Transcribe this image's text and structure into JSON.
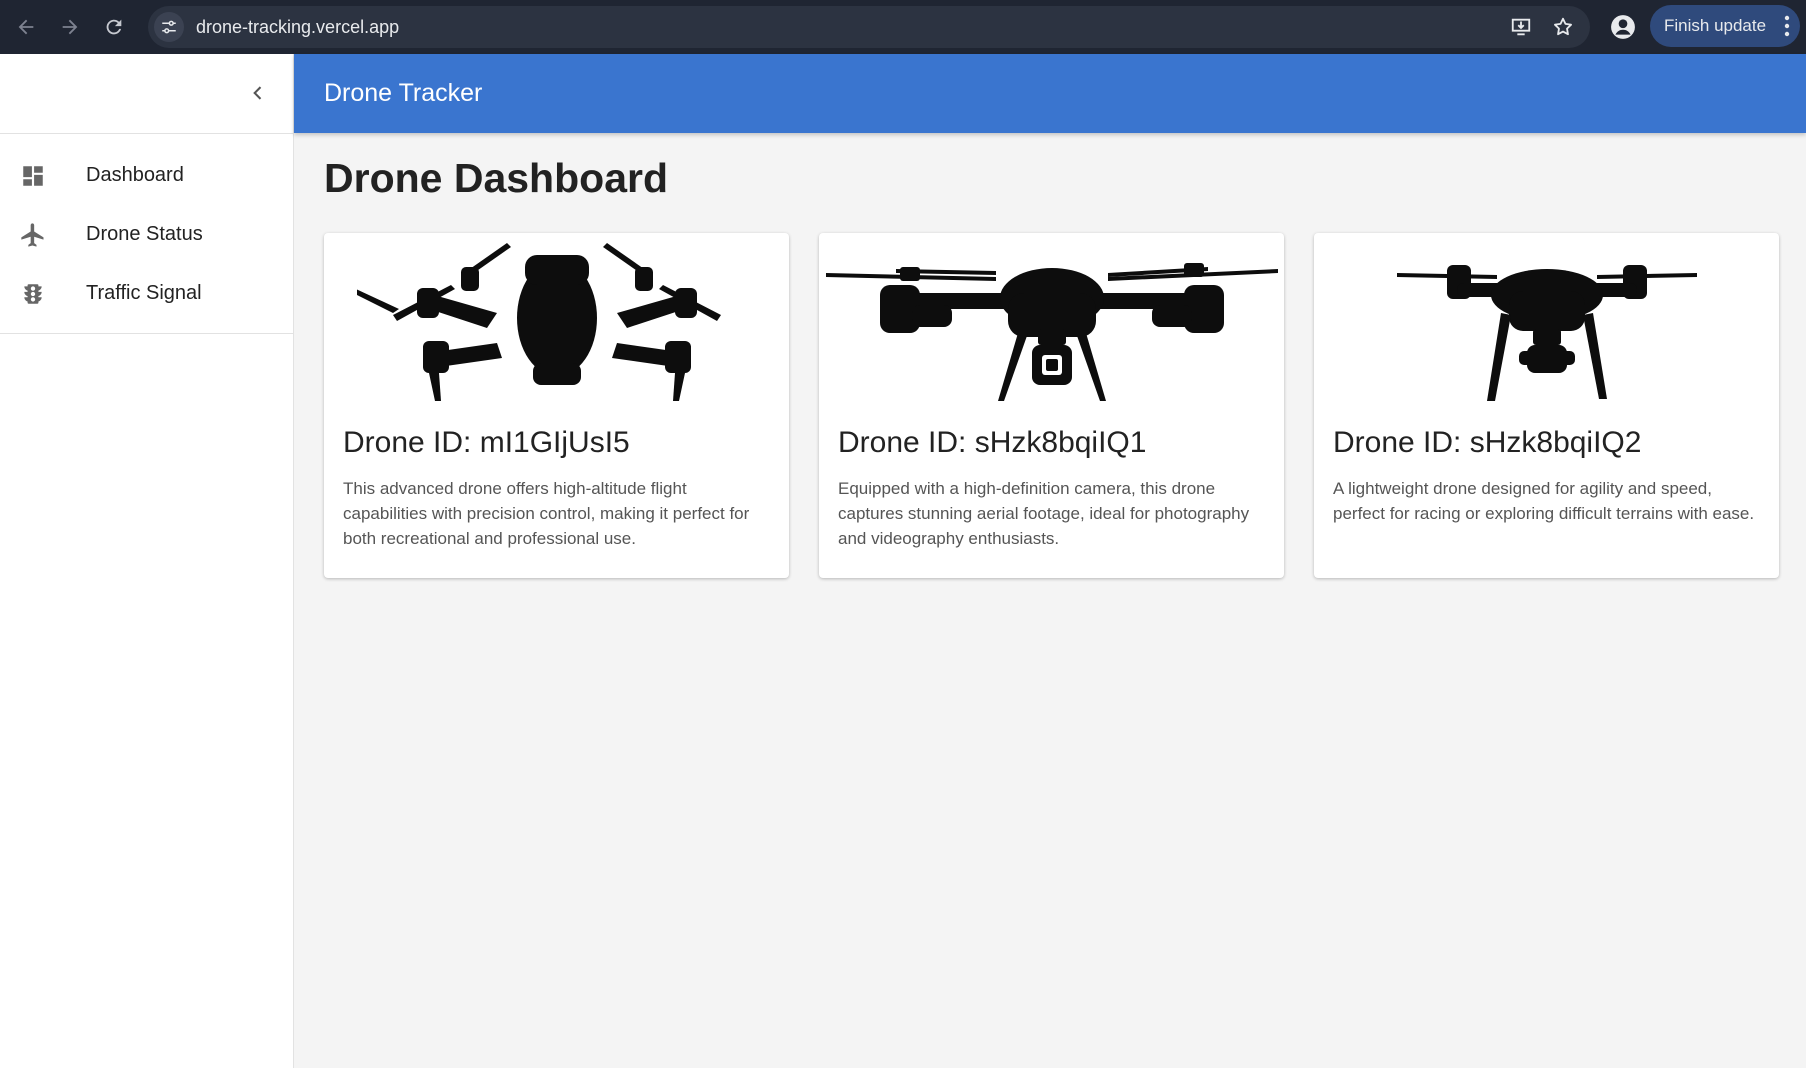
{
  "browser": {
    "url": "drone-tracking.vercel.app",
    "update_label": "Finish update",
    "icons": [
      "back-arrow-icon",
      "forward-arrow-icon",
      "reload-icon",
      "site-info-icon",
      "install-app-icon",
      "bookmark-star-icon",
      "profile-icon",
      "more-vert-icon"
    ]
  },
  "appbar": {
    "title": "Drone Tracker"
  },
  "sidebar": {
    "collapse_icon": "chevron-left-icon",
    "items": [
      {
        "label": "Dashboard",
        "icon": "dashboard-icon"
      },
      {
        "label": "Drone Status",
        "icon": "airplane-icon"
      },
      {
        "label": "Traffic Signal",
        "icon": "traffic-light-icon"
      }
    ]
  },
  "main": {
    "title": "Drone Dashboard",
    "cards": [
      {
        "title": "Drone ID: mI1GIjUsI5",
        "description": "This advanced drone offers high-altitude flight capabilities with precision control, making it perfect for both recreational and professional use.",
        "image": "folded-quadcopter-silhouette"
      },
      {
        "title": "Drone ID: sHzk8bqiIQ1",
        "description": "Equipped with a high-definition camera, this drone captures stunning aerial footage, ideal for photography and videography enthusiasts.",
        "image": "camera-quadcopter-silhouette"
      },
      {
        "title": "Drone ID: sHzk8bqiIQ2",
        "description": "A lightweight drone designed for agility and speed, perfect for racing or exploring difficult terrains with ease.",
        "image": "racing-quadcopter-silhouette"
      }
    ]
  },
  "colors": {
    "appbar": "#3a75cf",
    "chrome": "#1f2532",
    "background": "#f4f4f4"
  }
}
